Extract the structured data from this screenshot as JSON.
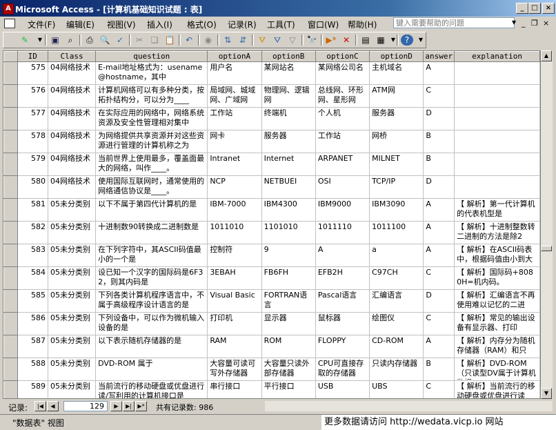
{
  "window": {
    "title": "Microsoft Access - [计算机基础知识试题 : 表]",
    "app_icon": "A"
  },
  "menu": {
    "items": [
      "文件(F)",
      "编辑(E)",
      "视图(V)",
      "插入(I)",
      "格式(O)",
      "记录(R)",
      "工具(T)",
      "窗口(W)",
      "帮助(H)"
    ],
    "ask_placeholder": "键入需要帮助的问题"
  },
  "table": {
    "columns": [
      "ID",
      "Class",
      "question",
      "optionA",
      "optionB",
      "optionC",
      "optionD",
      "answer",
      "explanation"
    ],
    "rows": [
      {
        "id": "575",
        "class": "04网络技术",
        "question": "E-mail地址格式为：usename@hostname，其中",
        "a": "用户名",
        "b": "某网站名",
        "c": "某网络公司名",
        "d": "主机域名",
        "answer": "A",
        "explanation": ""
      },
      {
        "id": "576",
        "class": "04网络技术",
        "question": "计算机网络可以有多种分类，按拓扑结构分，可以分为____",
        "a": "局域网、城域网、广域网",
        "b": "物理网、逻辑网",
        "c": "总线网、环形网、星形网",
        "d": "ATM网",
        "answer": "C",
        "explanation": ""
      },
      {
        "id": "577",
        "class": "04网络技术",
        "question": "在实际应用的网络中，网络系统资源及安全性管理相对集中",
        "a": "工作站",
        "b": "终端机",
        "c": "个人机",
        "d": "服务器",
        "answer": "D",
        "explanation": ""
      },
      {
        "id": "578",
        "class": "04网络技术",
        "question": "为网络提供共享资源并对这些资源进行管理的计算机称之为",
        "a": "网卡",
        "b": "服务器",
        "c": "工作站",
        "d": "网桥",
        "answer": "B",
        "explanation": ""
      },
      {
        "id": "579",
        "class": "04网络技术",
        "question": "当前世界上使用最多，覆盖面最大的网络，叫作____。",
        "a": "Intranet",
        "b": "Internet",
        "c": "ARPANET",
        "d": "MILNET",
        "answer": "B",
        "explanation": ""
      },
      {
        "id": "580",
        "class": "04网络技术",
        "question": "使用国际互联网时，通常使用的网络通信协议是____。",
        "a": "NCP",
        "b": "NETBUEI",
        "c": "OSI",
        "d": "TCP/IP",
        "answer": "D",
        "explanation": ""
      },
      {
        "id": "581",
        "class": "05未分类别",
        "question": "以下不属于第四代计算机的是",
        "a": "IBM-7000",
        "b": "IBM4300",
        "c": "IBM9000",
        "d": "IBM3090",
        "answer": "A",
        "explanation": "【 解析】第一代计算机的代表机型是"
      },
      {
        "id": "582",
        "class": "05未分类别",
        "question": "十进制数90转换成二进制数是",
        "a": "1011010",
        "b": "1101010",
        "c": "1011110",
        "d": "1011100",
        "answer": "A",
        "explanation": "【 解析】十进制整数转二进制的方法是除2"
      },
      {
        "id": "583",
        "class": "05未分类别",
        "question": "在下列字符中，其ASCII码值最小的一个是",
        "a": "控制符",
        "b": "9",
        "c": "A",
        "d": "a",
        "answer": "A",
        "explanation": "【 解析】在ASCII码表中，根据码值由小到大"
      },
      {
        "id": "584",
        "class": "05未分类别",
        "question": "设已知一个汉字的国际码是6F32，则其内码是",
        "a": "3EBAH",
        "b": "FB6FH",
        "c": "EFB2H",
        "d": "C97CH",
        "answer": "C",
        "explanation": "【 解析】国际码+8080H=机内码。"
      },
      {
        "id": "585",
        "class": "05未分类别",
        "question": "下列各类计算机程序语言中，不属于高级程序设计语言的是",
        "a": "Visual Basic",
        "b": "FORTRAN语言",
        "c": "Pascal语言",
        "d": "汇编语言",
        "answer": "D",
        "explanation": "【 解析】汇编语言不再使用难以记忆的二进"
      },
      {
        "id": "586",
        "class": "05未分类别",
        "question": "下列设备中，可以作为微机输入设备的是",
        "a": "打印机",
        "b": "显示器",
        "c": "鼠标器",
        "d": "绘图仪",
        "answer": "C",
        "explanation": "【 解析】常见的输出设备有显示器、打印"
      },
      {
        "id": "587",
        "class": "05未分类别",
        "question": "以下表示随机存储器的是",
        "a": "RAM",
        "b": "ROM",
        "c": "FLOPPY",
        "d": "CD-ROM",
        "answer": "A",
        "explanation": "【 解析】内存分为随机存储器（RAM）和只"
      },
      {
        "id": "588",
        "class": "05未分类别",
        "question": "DVD-ROM 属于",
        "a": "大容量可读可写外存储器",
        "b": "大容量只读外部存储器",
        "c": "CPU可直接存取的存储器",
        "d": "只读内存储器",
        "answer": "B",
        "explanation": "【 解析】DVD-ROM（只读型DV属于计算机数据"
      },
      {
        "id": "589",
        "class": "05未分类别",
        "question": "当前流行的移动硬盘或优盘进行读/写利用的计算机接口是",
        "a": "串行接口",
        "b": "平行接口",
        "c": "USB",
        "d": "UBS",
        "answer": "C",
        "explanation": "【 解析】当前流行的移动硬盘或优盘进行读"
      }
    ]
  },
  "navigation": {
    "label": "记录:",
    "current": "129",
    "total_text": "共有记录数: 986"
  },
  "status": {
    "view": "\"数据表\" 视图",
    "watermark": "更多数据请访问 http://wedata.vicp.io 网站"
  }
}
